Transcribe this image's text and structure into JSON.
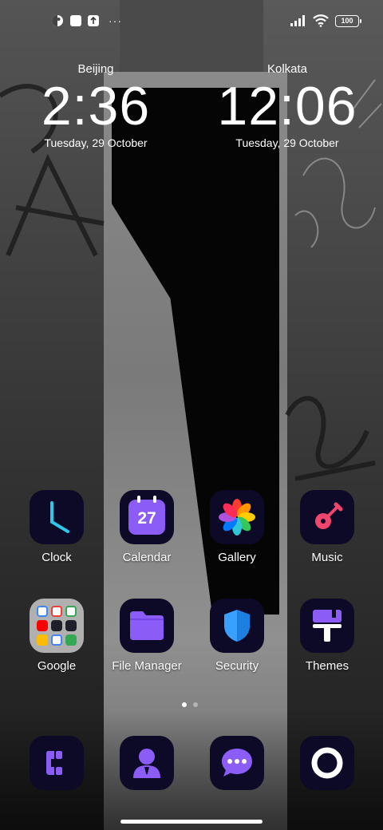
{
  "status_bar": {
    "left_icons": [
      "weather-app-icon",
      "square-notification-icon",
      "upload-notification-icon",
      "more-dots-icon"
    ],
    "more": "···",
    "signal": "signal-icon",
    "wifi": "wifi-icon",
    "battery": "100"
  },
  "clocks": [
    {
      "city": "Beijing",
      "time": "2:36",
      "date": "Tuesday, 29 October"
    },
    {
      "city": "Kolkata",
      "time": "12:06",
      "date": "Tuesday, 29 October"
    }
  ],
  "apps": [
    {
      "label": "Clock",
      "icon": "clock-icon"
    },
    {
      "label": "Calendar",
      "icon": "calendar-icon",
      "badge": "27"
    },
    {
      "label": "Gallery",
      "icon": "gallery-icon"
    },
    {
      "label": "Music",
      "icon": "music-icon"
    },
    {
      "label": "Google",
      "icon": "google-folder-icon"
    },
    {
      "label": "File Manager",
      "icon": "folder-icon"
    },
    {
      "label": "Security",
      "icon": "shield-icon"
    },
    {
      "label": "Themes",
      "icon": "paint-roller-icon"
    }
  ],
  "dock": [
    {
      "icon": "phone-icon"
    },
    {
      "icon": "contacts-icon"
    },
    {
      "icon": "messaging-icon"
    },
    {
      "icon": "camera-icon"
    }
  ],
  "page_indicator": {
    "pages": 2,
    "active": 0
  },
  "colors": {
    "icon_bg": "#0c0a26",
    "accent_purple": "#8b5cf6",
    "clock_hand": "#2fc6e8",
    "music_red": "#f0466e",
    "security_blue": "#3aa0ff"
  }
}
